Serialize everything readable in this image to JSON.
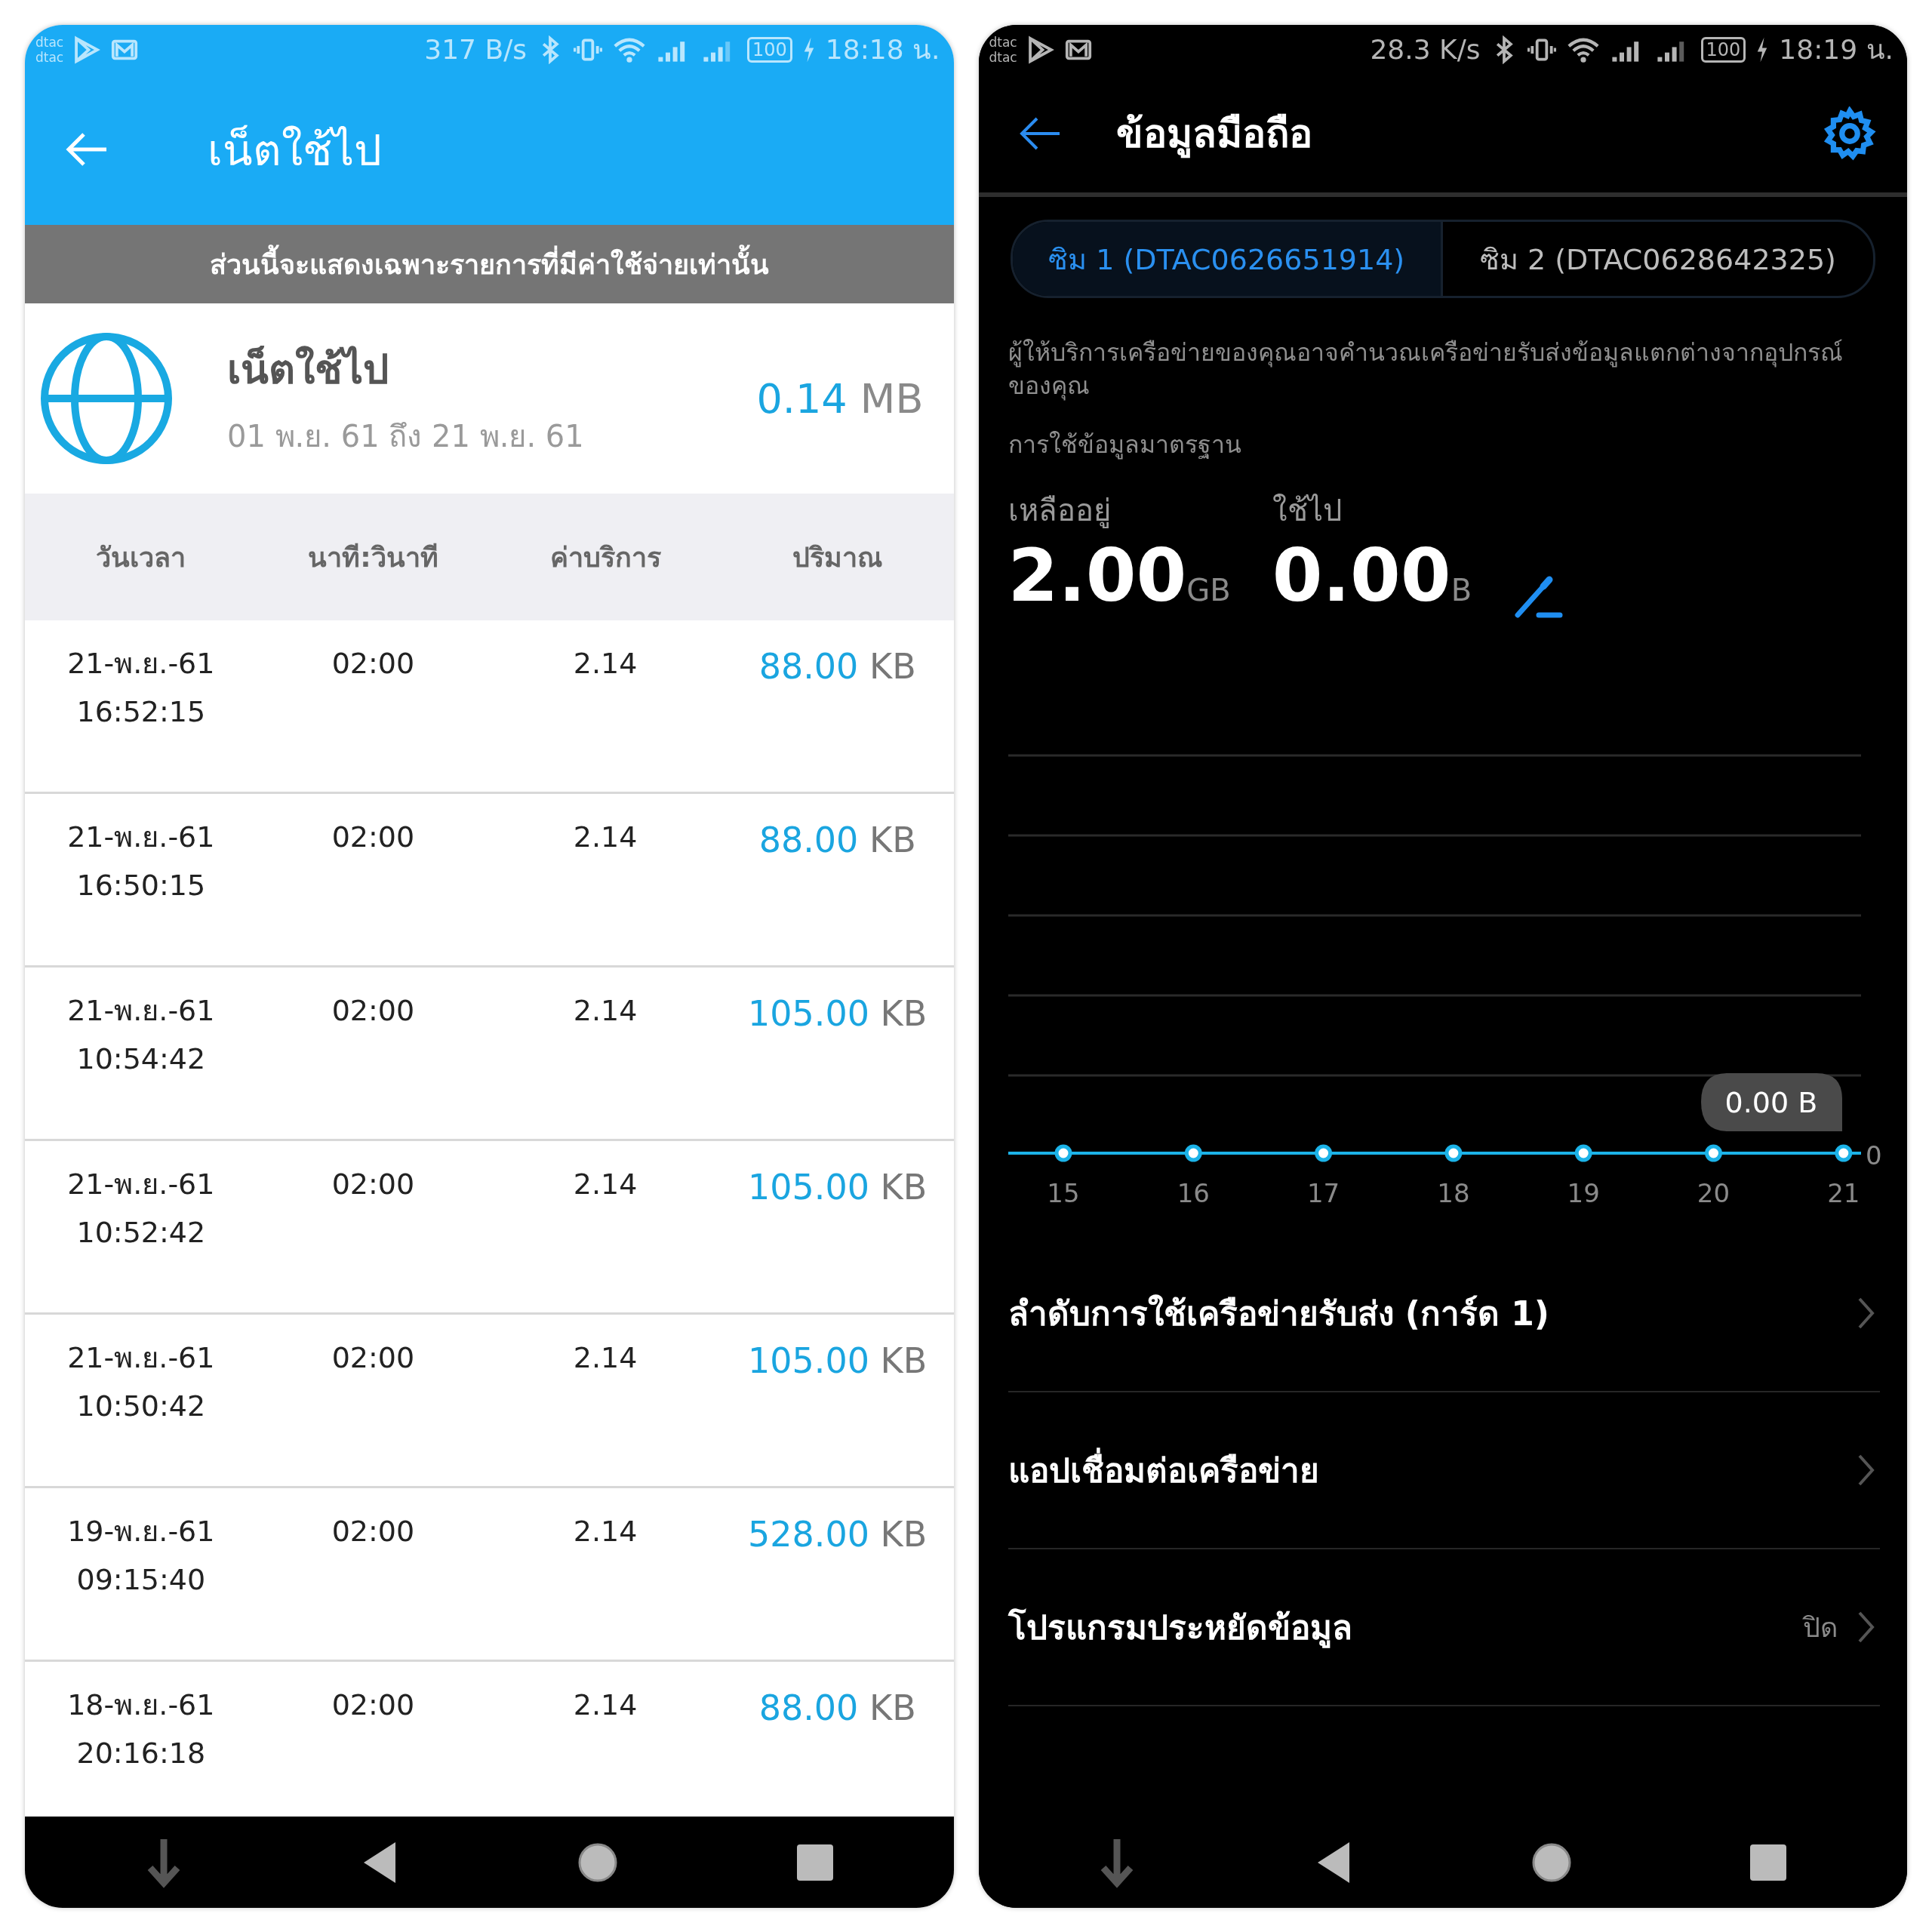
{
  "left": {
    "status_bar": {
      "carriers": [
        "dtac",
        "dtac"
      ],
      "speed": "317 B/s",
      "battery": "100",
      "time": "18:18 น."
    },
    "app_bar": {
      "title": "เน็ตใช้ไป"
    },
    "notice": "ส่วนนี้จะแสดงเฉพาะรายการที่มีค่าใช้จ่ายเท่านั้น",
    "summary": {
      "title": "เน็ตใช้ไป",
      "period": "01 พ.ย. 61 ถึง 21 พ.ย. 61",
      "amount": "0.14",
      "unit": "MB"
    },
    "table": {
      "columns": [
        "วันเวลา",
        "นาที:วินาที",
        "ค่าบริการ",
        "ปริมาณ"
      ],
      "rows": [
        {
          "date": "21-พ.ย.-61",
          "time": "16:52:15",
          "duration": "02:00",
          "fee": "2.14",
          "amount": "88.00",
          "unit": "KB"
        },
        {
          "date": "21-พ.ย.-61",
          "time": "16:50:15",
          "duration": "02:00",
          "fee": "2.14",
          "amount": "88.00",
          "unit": "KB"
        },
        {
          "date": "21-พ.ย.-61",
          "time": "10:54:42",
          "duration": "02:00",
          "fee": "2.14",
          "amount": "105.00",
          "unit": "KB"
        },
        {
          "date": "21-พ.ย.-61",
          "time": "10:52:42",
          "duration": "02:00",
          "fee": "2.14",
          "amount": "105.00",
          "unit": "KB"
        },
        {
          "date": "21-พ.ย.-61",
          "time": "10:50:42",
          "duration": "02:00",
          "fee": "2.14",
          "amount": "105.00",
          "unit": "KB"
        },
        {
          "date": "19-พ.ย.-61",
          "time": "09:15:40",
          "duration": "02:00",
          "fee": "2.14",
          "amount": "528.00",
          "unit": "KB"
        },
        {
          "date": "18-พ.ย.-61",
          "time": "20:16:18",
          "duration": "02:00",
          "fee": "2.14",
          "amount": "88.00",
          "unit": "KB"
        }
      ]
    }
  },
  "right": {
    "status_bar": {
      "carriers": [
        "dtac",
        "dtac"
      ],
      "speed": "28.3 K/s",
      "battery": "100",
      "time": "18:19 น."
    },
    "app_bar": {
      "title": "ข้อมูลมือถือ"
    },
    "tabs": [
      {
        "label": "ซิม 1 (DTAC0626651914)",
        "selected": true
      },
      {
        "label": "ซิม 2 (DTAC0628642325)",
        "selected": false
      }
    ],
    "description": "ผู้ให้บริการเครือข่ายของคุณอาจคำนวณเครือข่ายรับส่งข้อมูลแตกต่างจากอุปกรณ์ของคุณ",
    "section_label": "การใช้ข้อมูลมาตรฐาน",
    "stats": [
      {
        "label": "เหลืออยู่",
        "value": "2.00",
        "unit": "GB"
      },
      {
        "label": "ใช้ไป",
        "value": "0.00",
        "unit": "B"
      }
    ],
    "chart": {
      "tooltip": "0.00 B",
      "axis_label": "0",
      "x_labels": [
        "15",
        "16",
        "17",
        "18",
        "19",
        "20",
        "21"
      ]
    },
    "menu": [
      {
        "label": "ลำดับการใช้เครือข่ายรับส่ง (การ์ด 1)"
      },
      {
        "label": "แอปเชื่อมต่อเครือข่าย"
      },
      {
        "label": "โปรแกรมประหยัดข้อมูล",
        "value": "ปิด"
      }
    ]
  }
}
